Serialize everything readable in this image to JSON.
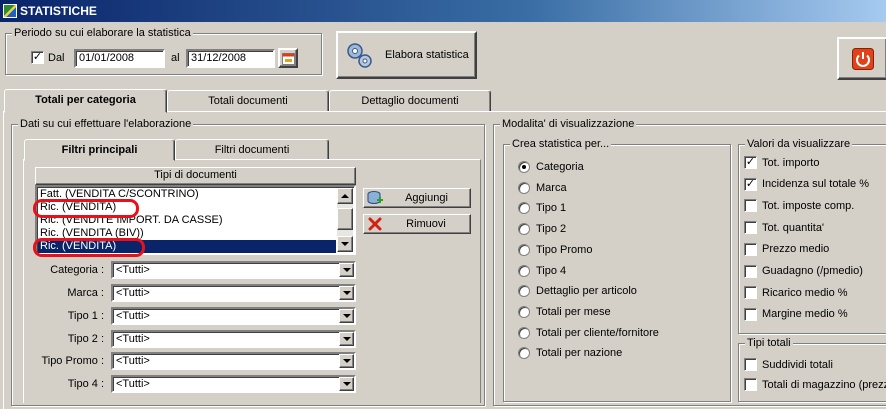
{
  "window": {
    "title": "STATISTICHE"
  },
  "period": {
    "legend": "Periodo su cui elaborare la statistica",
    "from_checked": true,
    "from_label": "Dal",
    "from_value": "01/01/2008",
    "to_label": "al",
    "to_value": "31/12/2008"
  },
  "toolbar": {
    "elabora_label": "Elabora statistica"
  },
  "main_tabs": [
    "Totali per categoria",
    "Totali documenti",
    "Dettaglio documenti"
  ],
  "data_group": {
    "legend": "Dati su cui effettuare l'elaborazione"
  },
  "sub_tabs": [
    "Filtri principali",
    "Filtri documenti"
  ],
  "doc_types": {
    "header": "Tipi di documenti",
    "items": [
      "Fatt. (VENDITA C/SCONTRINO)",
      "Ric. (VENDITA)",
      "Ric. (VENDITE IMPORT. DA CASSE)",
      "Ric. (VENDITA (BIV))",
      "Ric. (VENDITA)"
    ],
    "selected_index": 4,
    "add_label": "Aggiungi",
    "remove_label": "Rimuovi"
  },
  "filters": [
    {
      "label": "Categoria :",
      "value": "<Tutti>"
    },
    {
      "label": "Marca :",
      "value": "<Tutti>"
    },
    {
      "label": "Tipo 1 :",
      "value": "<Tutti>"
    },
    {
      "label": "Tipo 2 :",
      "value": "<Tutti>"
    },
    {
      "label": "Tipo Promo :",
      "value": "<Tutti>"
    },
    {
      "label": "Tipo 4 :",
      "value": "<Tutti>"
    }
  ],
  "display_mode": {
    "legend": "Modalita' di visualizzazione",
    "create_legend": "Crea statistica per...",
    "create_options": [
      "Categoria",
      "Marca",
      "Tipo 1",
      "Tipo 2",
      "Tipo Promo",
      "Tipo 4",
      "Dettaglio per articolo",
      "Totali per mese",
      "Totali per cliente/fornitore",
      "Totali per nazione"
    ],
    "create_selected": 0,
    "values_legend": "Valori da visualizzare",
    "values": [
      {
        "label": "Tot. importo",
        "checked": true
      },
      {
        "label": "Incidenza sul totale %",
        "checked": true
      },
      {
        "label": "Tot. imposte comp.",
        "checked": false
      },
      {
        "label": "Tot. quantita'",
        "checked": false
      },
      {
        "label": "Prezzo medio",
        "checked": false
      },
      {
        "label": "Guadagno (/pmedio)",
        "checked": false
      },
      {
        "label": "Ricarico medio %",
        "checked": false
      },
      {
        "label": "Margine medio %",
        "checked": false
      }
    ],
    "totals_legend": "Tipi totali",
    "totals": [
      {
        "label": "Suddividi totali",
        "checked": false
      },
      {
        "label": "Totali di magazzino (prezz",
        "checked": false
      }
    ]
  },
  "icons": {
    "calendar": "calendar-icon",
    "elabora": "gears-icon",
    "exit": "power-icon",
    "add": "add-db-icon",
    "remove": "red-x-icon"
  },
  "colors": {
    "title_start": "#0a246a",
    "selection": "#0a246a",
    "highlight_mark": "#e8101a",
    "exit_button": "#e0421a"
  }
}
